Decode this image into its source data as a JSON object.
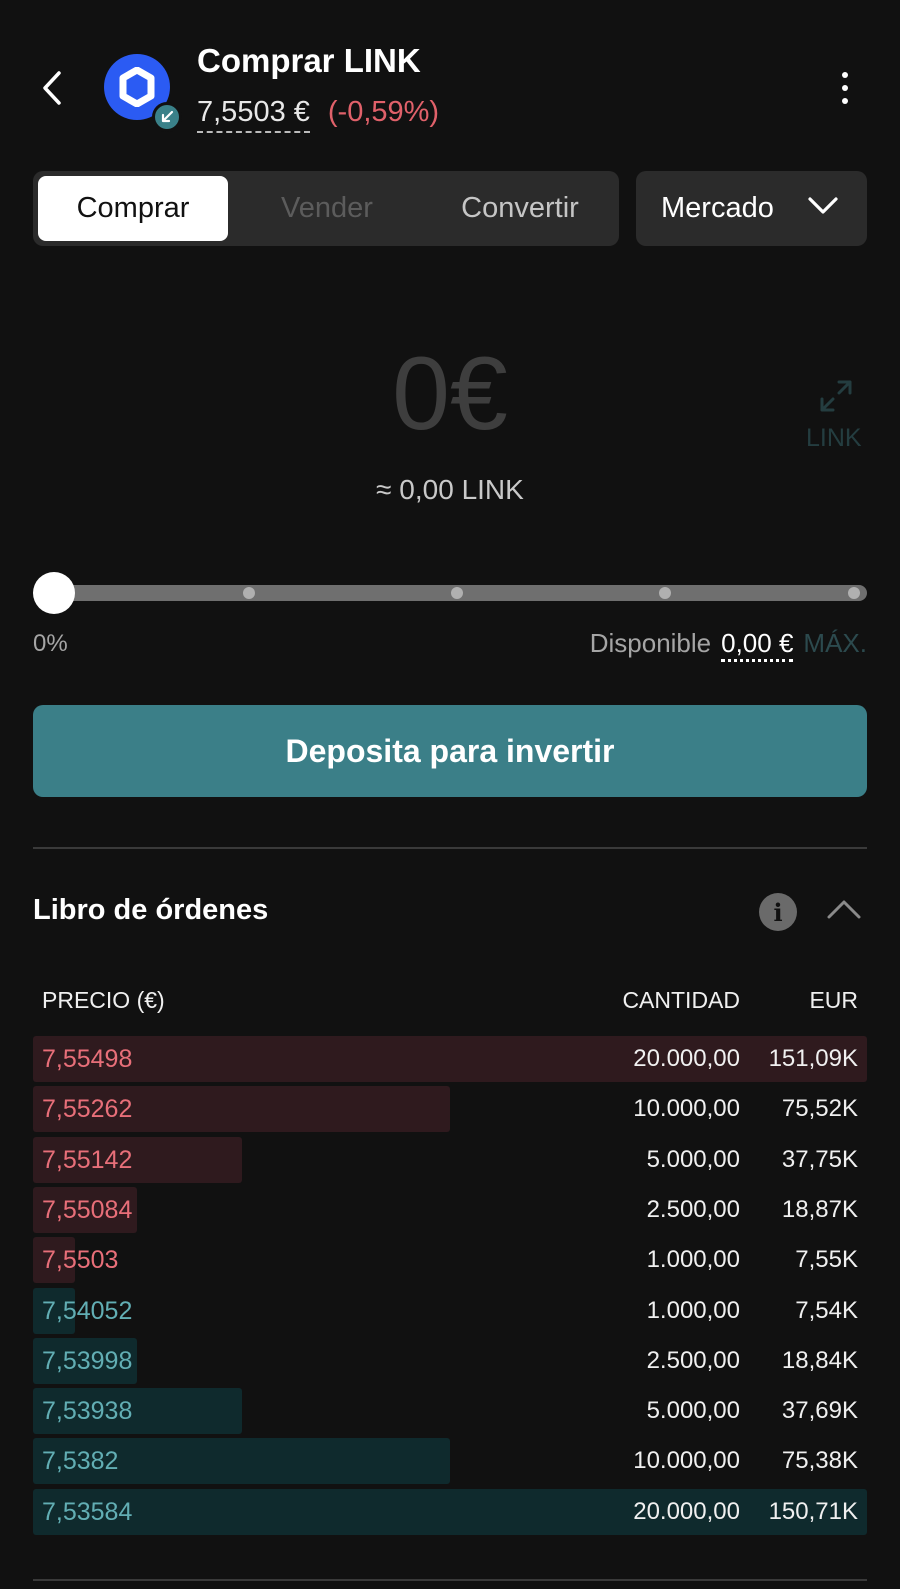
{
  "header": {
    "title": "Comprar LINK",
    "price": "7,5503 €",
    "change": "(-0,59%)"
  },
  "tabs": [
    {
      "label": "Comprar",
      "active": true
    },
    {
      "label": "Vender",
      "active": false
    },
    {
      "label": "Convertir",
      "active": false
    }
  ],
  "order_type": "Mercado",
  "amount": {
    "value": "0€",
    "approx": "≈ 0,00 LINK",
    "swap_unit": "LINK"
  },
  "slider": {
    "percent_label": "0%",
    "value_fraction": 0,
    "available_label": "Disponible",
    "available_value": "0,00 €",
    "max_label": "MÁX."
  },
  "deposit_button": "Deposita para invertir",
  "order_book": {
    "title": "Libro de órdenes",
    "columns": {
      "price": "PRECIO (€)",
      "quantity": "CANTIDAD",
      "eur": "EUR"
    },
    "asks": [
      {
        "price": "7,55498",
        "quantity": "20.000,00",
        "eur": "151,09K"
      },
      {
        "price": "7,55262",
        "quantity": "10.000,00",
        "eur": "75,52K"
      },
      {
        "price": "7,55142",
        "quantity": "5.000,00",
        "eur": "37,75K"
      },
      {
        "price": "7,55084",
        "quantity": "2.500,00",
        "eur": "18,87K"
      },
      {
        "price": "7,5503",
        "quantity": "1.000,00",
        "eur": "7,55K"
      }
    ],
    "bids": [
      {
        "price": "7,54052",
        "quantity": "1.000,00",
        "eur": "7,54K"
      },
      {
        "price": "7,53998",
        "quantity": "2.500,00",
        "eur": "18,84K"
      },
      {
        "price": "7,53938",
        "quantity": "5.000,00",
        "eur": "37,69K"
      },
      {
        "price": "7,5382",
        "quantity": "10.000,00",
        "eur": "75,38K"
      },
      {
        "price": "7,53584",
        "quantity": "20.000,00",
        "eur": "150,71K"
      }
    ]
  },
  "colors": {
    "accent": "#3b7f88",
    "negative": "#e0616a",
    "ask": "#e86f79",
    "bid": "#62aeb4",
    "coin": "#2b5bf3"
  }
}
